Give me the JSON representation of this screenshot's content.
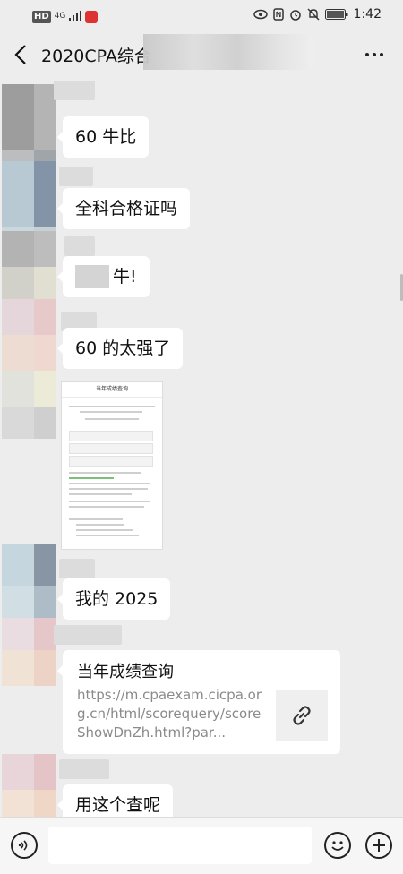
{
  "status_bar": {
    "hd": "HD",
    "network": "4G",
    "time": "1:42"
  },
  "header": {
    "title": "2020CPA综合"
  },
  "messages": [
    {
      "type": "text",
      "text": "60 牛比"
    },
    {
      "type": "text",
      "text": "全科合格证吗"
    },
    {
      "type": "text",
      "text": "牛!"
    },
    {
      "type": "text",
      "text": "60 的太强了"
    },
    {
      "type": "image",
      "title": "当年成绩查询"
    },
    {
      "type": "text",
      "text": "我的 2025"
    },
    {
      "type": "link",
      "title": "当年成绩查询",
      "url": "https://m.cpaexam.cicpa.org.cn/html/scorequery/scoreShowDnZh.html?par..."
    },
    {
      "type": "text",
      "text": "用这个查呢"
    }
  ],
  "input": {
    "placeholder": ""
  },
  "icons": {
    "back": "back-arrow-icon",
    "more": "more-icon",
    "voice": "voice-icon",
    "emoji": "emoji-icon",
    "plus": "plus-icon",
    "link": "link-icon"
  }
}
